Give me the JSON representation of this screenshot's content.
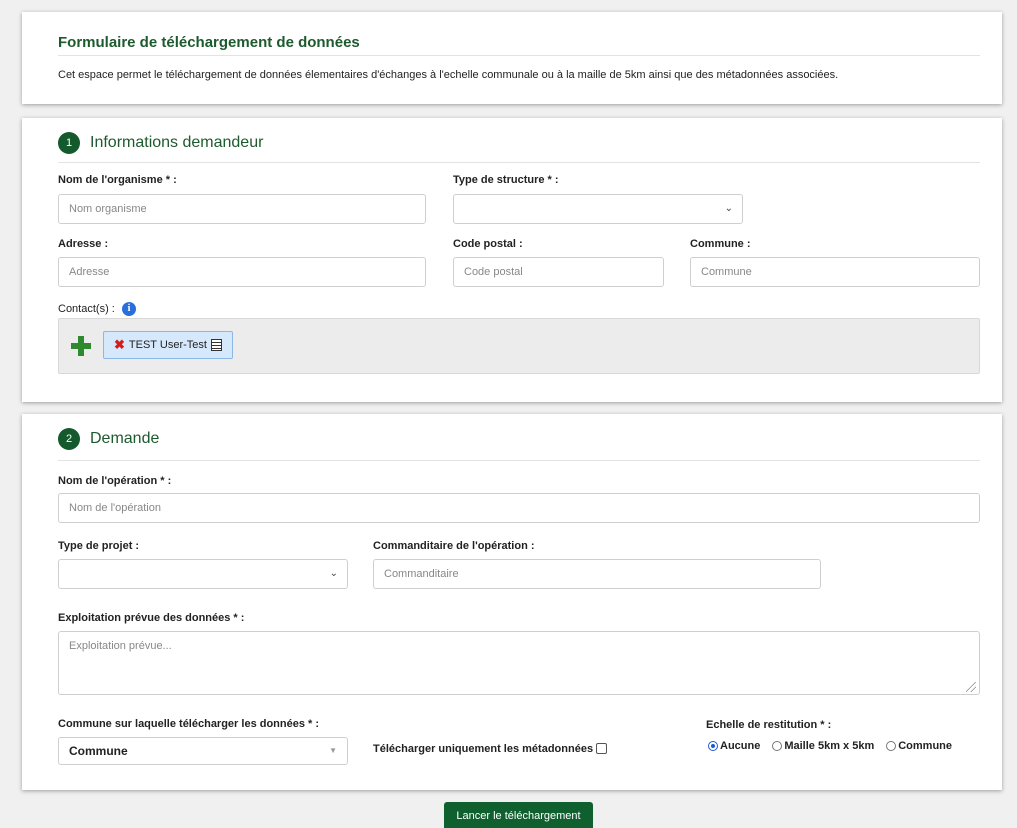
{
  "intro": {
    "title": "Formulaire de téléchargement de données",
    "text": "Cet espace permet le téléchargement de données élementaires d'échanges à l'echelle communale ou à la maille de 5km ainsi que des métadonnées associées."
  },
  "section1": {
    "number": "1",
    "title": "Informations demandeur",
    "org_label": "Nom de l'organisme * :",
    "org_placeholder": "Nom organisme",
    "structure_label": "Type de structure * :",
    "structure_value": "",
    "address_label": "Adresse :",
    "address_placeholder": "Adresse",
    "postal_label": "Code postal :",
    "postal_placeholder": "Code postal",
    "commune_label": "Commune :",
    "commune_placeholder": "Commune",
    "contacts_label": "Contact(s) :",
    "contacts": [
      "TEST User-Test"
    ]
  },
  "section2": {
    "number": "2",
    "title": "Demande",
    "operation_label": "Nom de l'opération * :",
    "operation_placeholder": "Nom de l'opération",
    "project_label": "Type de projet :",
    "project_value": "",
    "sponsor_label": "Commanditaire de l'opération :",
    "sponsor_placeholder": "Commanditaire",
    "usage_label": "Exploitation prévue des données * :",
    "usage_placeholder": "Exploitation prévue...",
    "commune_dl_label": "Commune sur laquelle télécharger les données * :",
    "commune_dl_value": "Commune",
    "metadata_only_label": "Télécharger uniquement les métadonnées",
    "metadata_only_checked": false,
    "scale_label": "Echelle de restitution * :",
    "scale_options": [
      "Aucune",
      "Maille 5km x 5km",
      "Commune"
    ],
    "scale_selected": "Aucune"
  },
  "submit_label": "Lancer le téléchargement",
  "colors": {
    "brand_green": "#145a2c",
    "title_green": "#1d5b2e",
    "chip_bg": "#d6e8fb",
    "info_blue": "#2a6ed9"
  }
}
